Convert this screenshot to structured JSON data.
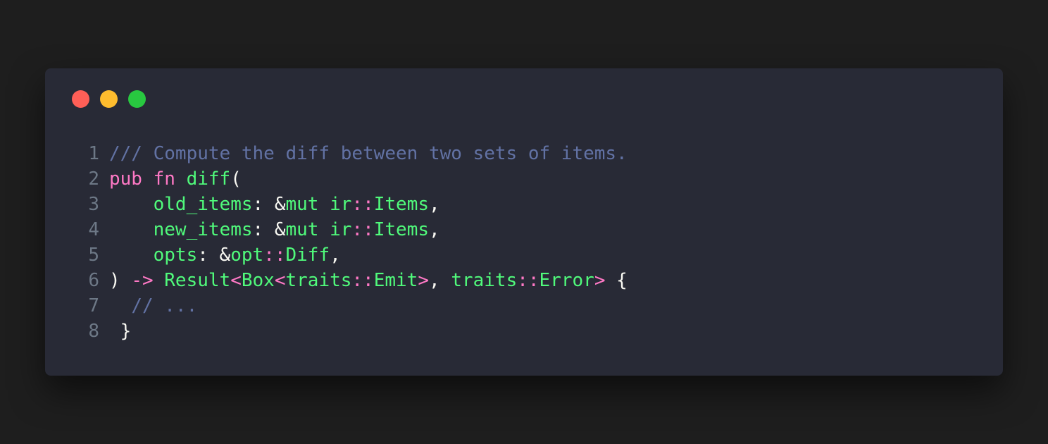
{
  "window": {
    "controls": {
      "close_color": "#ff5f57",
      "minimize_color": "#febc2e",
      "maximize_color": "#28c840"
    }
  },
  "code": {
    "line_numbers": [
      "1",
      "2",
      "3",
      "4",
      "5",
      "6",
      "7",
      "8"
    ],
    "lines": [
      [
        {
          "t": "/// Compute the diff between two sets of items.",
          "k": "comment"
        }
      ],
      [
        {
          "t": "pub",
          "k": "keyword"
        },
        {
          "t": " ",
          "k": "plain"
        },
        {
          "t": "fn",
          "k": "keyword"
        },
        {
          "t": " ",
          "k": "plain"
        },
        {
          "t": "diff",
          "k": "function"
        },
        {
          "t": "(",
          "k": "plain"
        }
      ],
      [
        {
          "t": "    ",
          "k": "plain"
        },
        {
          "t": "old_items",
          "k": "ident"
        },
        {
          "t": ": &",
          "k": "plain"
        },
        {
          "t": "mut",
          "k": "ident"
        },
        {
          "t": " ",
          "k": "plain"
        },
        {
          "t": "ir",
          "k": "ident"
        },
        {
          "t": "::",
          "k": "op"
        },
        {
          "t": "Items",
          "k": "type"
        },
        {
          "t": ",",
          "k": "plain"
        }
      ],
      [
        {
          "t": "    ",
          "k": "plain"
        },
        {
          "t": "new_items",
          "k": "ident"
        },
        {
          "t": ": &",
          "k": "plain"
        },
        {
          "t": "mut",
          "k": "ident"
        },
        {
          "t": " ",
          "k": "plain"
        },
        {
          "t": "ir",
          "k": "ident"
        },
        {
          "t": "::",
          "k": "op"
        },
        {
          "t": "Items",
          "k": "type"
        },
        {
          "t": ",",
          "k": "plain"
        }
      ],
      [
        {
          "t": "    ",
          "k": "plain"
        },
        {
          "t": "opts",
          "k": "ident"
        },
        {
          "t": ": &",
          "k": "plain"
        },
        {
          "t": "opt",
          "k": "ident"
        },
        {
          "t": "::",
          "k": "op"
        },
        {
          "t": "Diff",
          "k": "type"
        },
        {
          "t": ",",
          "k": "plain"
        }
      ],
      [
        {
          "t": ")",
          "k": "plain"
        },
        {
          "t": " ",
          "k": "plain"
        },
        {
          "t": "->",
          "k": "op"
        },
        {
          "t": " ",
          "k": "plain"
        },
        {
          "t": "Result",
          "k": "type"
        },
        {
          "t": "<",
          "k": "op"
        },
        {
          "t": "Box",
          "k": "type"
        },
        {
          "t": "<",
          "k": "op"
        },
        {
          "t": "traits",
          "k": "ident"
        },
        {
          "t": "::",
          "k": "op"
        },
        {
          "t": "Emit",
          "k": "type"
        },
        {
          "t": ">",
          "k": "op"
        },
        {
          "t": ", ",
          "k": "plain"
        },
        {
          "t": "traits",
          "k": "ident"
        },
        {
          "t": "::",
          "k": "op"
        },
        {
          "t": "Error",
          "k": "type"
        },
        {
          "t": ">",
          "k": "op"
        },
        {
          "t": " {",
          "k": "plain"
        }
      ],
      [
        {
          "t": "  ",
          "k": "plain"
        },
        {
          "t": "// ...",
          "k": "comment"
        }
      ],
      [
        {
          "t": " }",
          "k": "plain"
        }
      ]
    ]
  }
}
